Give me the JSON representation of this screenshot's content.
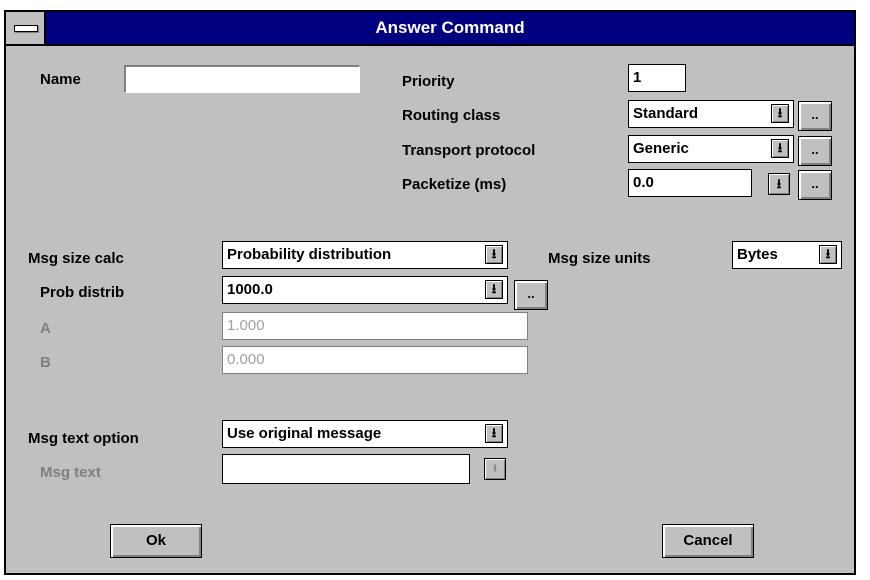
{
  "window": {
    "title": "Answer Command"
  },
  "name": {
    "label": "Name",
    "value": ""
  },
  "priority": {
    "label": "Priority",
    "value": "1"
  },
  "routing_class": {
    "label": "Routing class",
    "value": "Standard"
  },
  "transport_protocol": {
    "label": "Transport protocol",
    "value": "Generic"
  },
  "packetize": {
    "label": "Packetize (ms)",
    "value": "0.0"
  },
  "msg_size_calc": {
    "label": "Msg size calc",
    "value": "Probability distribution"
  },
  "msg_size_units": {
    "label": "Msg size units",
    "value": "Bytes"
  },
  "prob_distrib": {
    "label": "Prob distrib",
    "value": "1000.0"
  },
  "param_a": {
    "label": "A",
    "value": "1.000"
  },
  "param_b": {
    "label": "B",
    "value": "0.000"
  },
  "msg_text_option": {
    "label": "Msg text option",
    "value": "Use original message"
  },
  "msg_text": {
    "label": "Msg text",
    "value": ""
  },
  "dropdown_glyph": "⭳",
  "ellipsis": "..",
  "buttons": {
    "ok": "Ok",
    "cancel": "Cancel"
  }
}
